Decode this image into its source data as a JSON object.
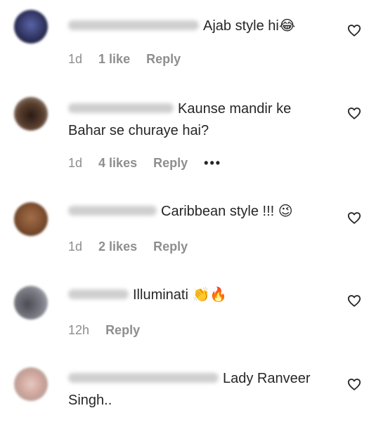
{
  "comments": [
    {
      "username": "ammukkhanna0001",
      "text": "Ajab style hi",
      "emoji": "😂",
      "time": "1d",
      "likes": "1 like",
      "reply": "Reply",
      "avatar_color": "#3a3f6a"
    },
    {
      "username": "csobakashe11",
      "text": "Kaunse mandir ke Bahar se churaye hai?",
      "emoji": "",
      "time": "1d",
      "likes": "4 likes",
      "reply": "Reply",
      "more": "•••",
      "avatar_color": "#4a3428"
    },
    {
      "username": "himmubhatia",
      "text": "Caribbean style !!! ",
      "emoji": "😉",
      "time": "1d",
      "likes": "2 likes",
      "reply": "Reply",
      "avatar_color": "#8a5a3a"
    },
    {
      "username": "Wiskish",
      "text": "Illuminati ",
      "emoji": "👏🔥",
      "time": "12h",
      "likes": "",
      "reply": "Reply",
      "avatar_color": "#6e6e78"
    },
    {
      "username": "deepti_righana_adkar",
      "text": "Lady Ranveer Singh..",
      "emoji": "",
      "time": "",
      "likes": "",
      "reply": "",
      "avatar_color": "#cfa9a2"
    }
  ],
  "heart_icon": "heart-outline-icon"
}
